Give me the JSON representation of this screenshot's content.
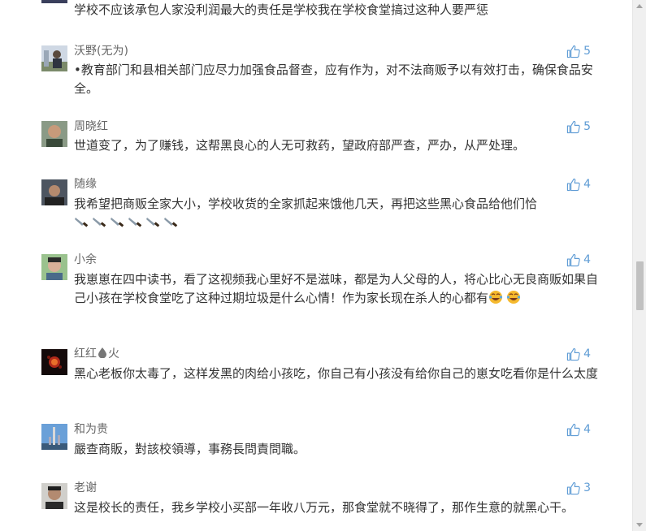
{
  "colors": {
    "like_blue": "#5f9cd5",
    "author_gray": "#666666",
    "text": "#333333"
  },
  "comments": [
    {
      "author": "",
      "text": "学校不应该承包人家没利润最大的责任是学校我在学校食堂搞过这种人要严惩",
      "likes": ""
    },
    {
      "author": "沃野(无为)",
      "text": "•教育部门和县相关部门应尽力加强食品督查，应有作为，对不法商贩予以有效打击，确保食品安全。",
      "likes": "5"
    },
    {
      "author": "周晓红",
      "text": "世道变了，为了赚钱，这帮黑良心的人无可救药，望政府部严查，严办，从严处理。",
      "likes": "5"
    },
    {
      "author": "随缘",
      "text": "我希望把商贩全家大小，学校收货的全家抓起来饿他几天，再把这些黑心食品给他们恰",
      "likes": "4",
      "emoji": [
        "knife-icon",
        "knife-icon",
        "knife-icon",
        "knife-icon",
        "knife-icon",
        "knife-icon"
      ]
    },
    {
      "author": "小余",
      "text": "我崽崽在四中读书，看了这视频我心里好不是滋味，都是为人父母的人，将心比心无良商贩如果自己小孩在学校食堂吃了这种过期垃圾是什么心情！作为家长现在杀人的心都有",
      "likes": "4",
      "emoji": [
        "tears-of-joy-icon",
        "tears-of-joy-icon"
      ]
    },
    {
      "author": "红红",
      "author_suffix": "火",
      "text": "黑心老板你太毒了，这样发黑的肉给小孩吃，你自己有小孩没有给你自己的崽女吃看你是什么太度",
      "likes": "4"
    },
    {
      "author": "和为贵",
      "text": "嚴查商販，對該校領導，事務長問責問職。",
      "likes": "4"
    },
    {
      "author": "老谢",
      "text": "这是校长的责任，我乡学校小买部一年收八万元，那食堂就不晓得了，那作生意的就黑心干。",
      "likes": "3"
    }
  ]
}
